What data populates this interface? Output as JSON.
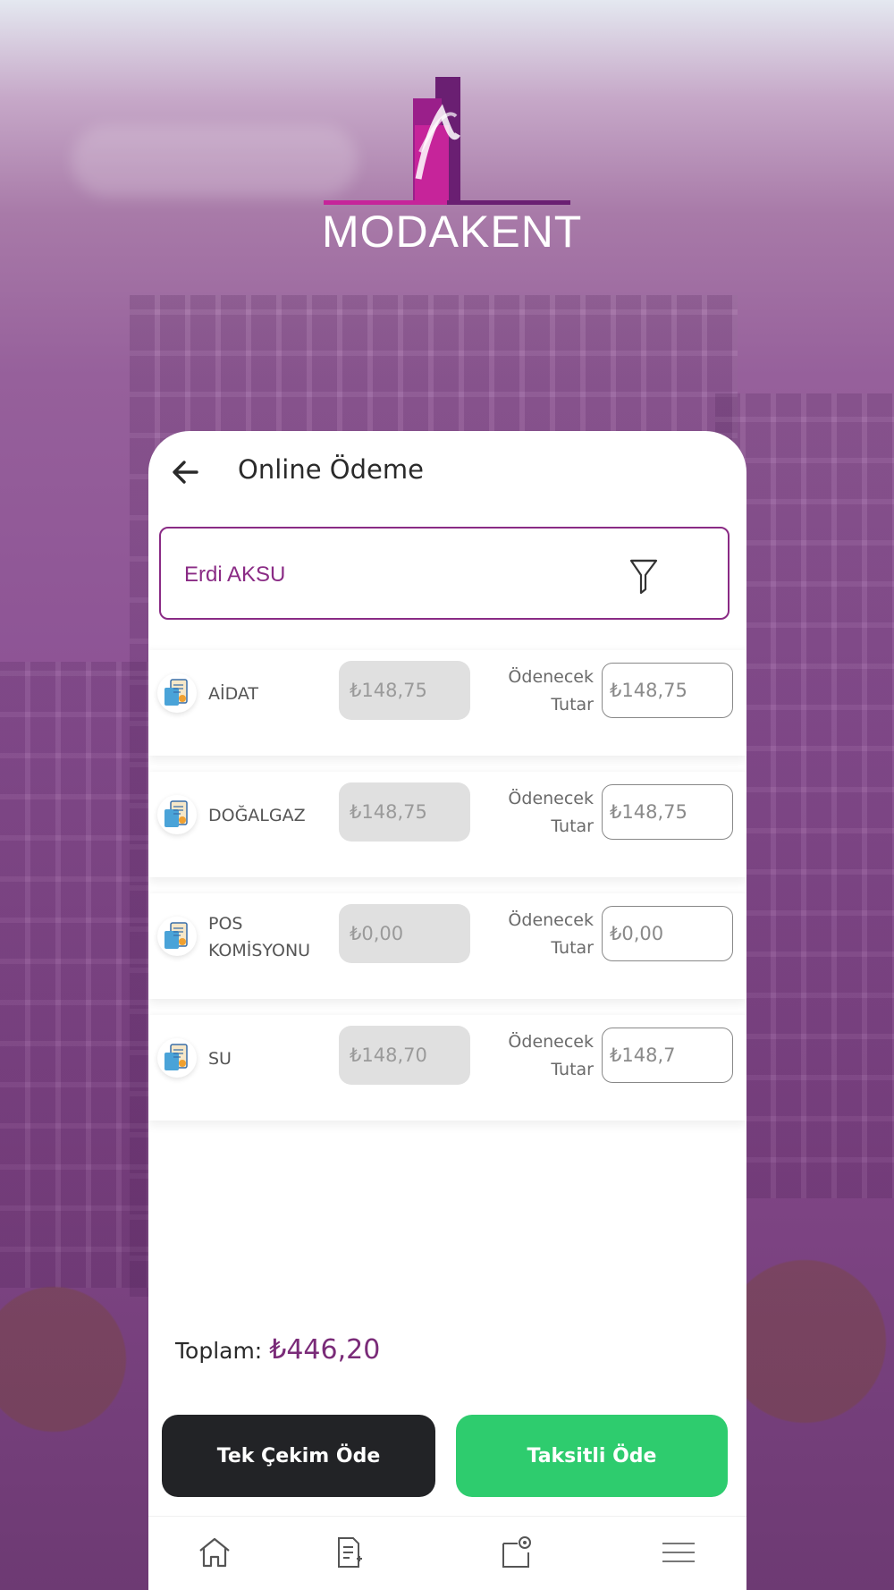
{
  "brand": {
    "name": "MODAKENT",
    "colors": {
      "primary": "#8a2b85",
      "accent_light": "#c6249a",
      "accent_dark": "#5c2066",
      "pay_single": "#222326",
      "pay_installment": "#2ecc6e"
    }
  },
  "header": {
    "title": "Online Ödeme",
    "back_icon": "arrow-left-icon"
  },
  "filter": {
    "value": "Erdi AKSU",
    "icon": "filter-funnel-icon"
  },
  "items": [
    {
      "label": "AİDAT",
      "debt": "₺148,75",
      "pay_label": "Ödenecek Tutar",
      "pay_value": "₺148,75",
      "icon": "bill-icon"
    },
    {
      "label": "DOĞALGAZ",
      "debt": "₺148,75",
      "pay_label": "Ödenecek Tutar",
      "pay_value": "₺148,75",
      "icon": "bill-icon"
    },
    {
      "label": "POS KOMİSYONU",
      "debt": "₺0,00",
      "pay_label": "Ödenecek Tutar",
      "pay_value": "₺0,00",
      "icon": "bill-icon"
    },
    {
      "label": "SU",
      "debt": "₺148,70",
      "pay_label": "Ödenecek Tutar",
      "pay_value": "₺148,7",
      "icon": "bill-icon"
    }
  ],
  "total": {
    "label": "Toplam:",
    "value": "₺446,20"
  },
  "actions": {
    "single": "Tek Çekim Öde",
    "installment": "Taksitli Öde"
  },
  "bottom_nav": [
    {
      "icon": "home-icon"
    },
    {
      "icon": "document-icon"
    },
    {
      "icon": "card-icon"
    },
    {
      "icon": "menu-icon"
    }
  ]
}
